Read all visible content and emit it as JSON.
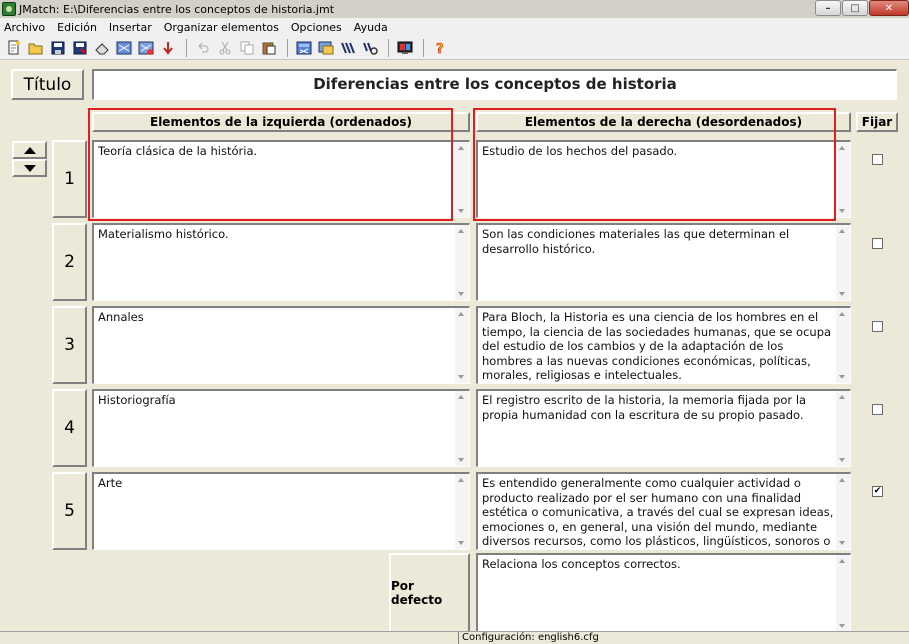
{
  "window": {
    "title": "JMatch: E:\\Diferencias entre los conceptos de historia.jmt"
  },
  "menu": [
    "Archivo",
    "Edición",
    "Insertar",
    "Organizar elementos",
    "Opciones",
    "Ayuda"
  ],
  "toolbar": {
    "icons": [
      "new-file-icon",
      "open-folder-icon",
      "save-icon",
      "save-as-icon",
      "eraser-icon",
      "export-web-icon",
      "export-web2-icon",
      "arrow-down-icon",
      "undo-icon",
      "cut-icon",
      "copy-icon",
      "paste-icon",
      "web-page-icon",
      "drag-drop-icon",
      "config-icon",
      "search-config-icon",
      "screen-icon",
      "help-icon"
    ]
  },
  "title": {
    "label": "Título",
    "value": "Diferencias entre los conceptos de historia"
  },
  "columns": {
    "left": "Elementos de la izquierda (ordenados)",
    "right": "Elementos de la derecha (desordenados)",
    "fix": "Fijar"
  },
  "rows": [
    {
      "num": "1",
      "left": "Teoría clásica de la história.",
      "right": " Estudio de los hechos del pasado.",
      "fixed": false
    },
    {
      "num": "2",
      "left": "Materialismo histórico.",
      "right": "Son las condiciones materiales las que determinan el desarrollo histórico.",
      "fixed": false
    },
    {
      "num": "3",
      "left": "Annales",
      "right": " Para Bloch, la Historia es una ciencia de los hombres en el tiempo, la ciencia de las sociedades humanas, que se ocupa del estudio de los cambios y de la adaptación de los hombres a las nuevas condiciones económicas, políticas, morales, religiosas e intelectuales.",
      "fixed": false
    },
    {
      "num": "4",
      "left": "Historiografía",
      "right": "El registro escrito de la historia, la memoria fijada por la propia humanidad con la escritura de su propio pasado.",
      "fixed": false
    },
    {
      "num": "5",
      "left": "Arte",
      "right": "Es entendido generalmente como cualquier actividad o producto realizado por el ser humano con una finalidad estética o comunicativa, a través del cual se expresan ideas, emociones o, en general, una visión del mundo, mediante diversos recursos, como los plásticos, lingüísticos, sonoros o mixtos.",
      "fixed": true
    }
  ],
  "default": {
    "label": "Por defecto",
    "value": "Relaciona los conceptos correctos."
  },
  "status": {
    "config": "Configuración: english6.cfg"
  }
}
